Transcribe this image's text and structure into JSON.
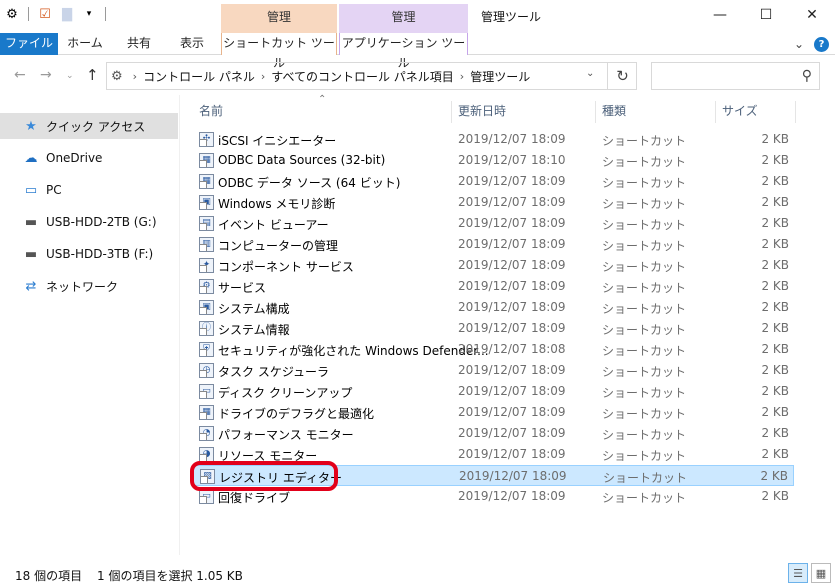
{
  "ribbon": {
    "context_group_1": "管理",
    "context_group_2": "管理",
    "window_title": "管理ツール",
    "tabs": [
      "ファイル",
      "ホーム",
      "共有",
      "表示",
      "ショートカット ツール",
      "アプリケーション ツール"
    ]
  },
  "address": {
    "crumbs": [
      "コントロール パネル",
      "すべてのコントロール パネル項目",
      "管理ツール"
    ]
  },
  "sidebar": {
    "items": [
      {
        "label": "クイック アクセス",
        "icon": "star-icon"
      },
      {
        "label": "OneDrive",
        "icon": "cloud-icon"
      },
      {
        "label": "PC",
        "icon": "pc-icon"
      },
      {
        "label": "USB-HDD-2TB (G:)",
        "icon": "drive-icon"
      },
      {
        "label": "USB-HDD-3TB (F:)",
        "icon": "drive-icon"
      },
      {
        "label": "ネットワーク",
        "icon": "network-icon"
      }
    ]
  },
  "columns": {
    "name": "名前",
    "date": "更新日時",
    "type": "種類",
    "size": "サイズ"
  },
  "files": [
    {
      "name": "iSCSI イニシエーター",
      "date": "2019/12/07 18:09",
      "type": "ショートカット",
      "size": "2 KB"
    },
    {
      "name": "ODBC Data Sources (32-bit)",
      "date": "2019/12/07 18:10",
      "type": "ショートカット",
      "size": "2 KB"
    },
    {
      "name": "ODBC データ ソース (64 ビット)",
      "date": "2019/12/07 18:09",
      "type": "ショートカット",
      "size": "2 KB"
    },
    {
      "name": "Windows メモリ診断",
      "date": "2019/12/07 18:09",
      "type": "ショートカット",
      "size": "2 KB"
    },
    {
      "name": "イベント ビューアー",
      "date": "2019/12/07 18:09",
      "type": "ショートカット",
      "size": "2 KB"
    },
    {
      "name": "コンピューターの管理",
      "date": "2019/12/07 18:09",
      "type": "ショートカット",
      "size": "2 KB"
    },
    {
      "name": "コンポーネント サービス",
      "date": "2019/12/07 18:09",
      "type": "ショートカット",
      "size": "2 KB"
    },
    {
      "name": "サービス",
      "date": "2019/12/07 18:09",
      "type": "ショートカット",
      "size": "2 KB"
    },
    {
      "name": "システム構成",
      "date": "2019/12/07 18:09",
      "type": "ショートカット",
      "size": "2 KB"
    },
    {
      "name": "システム情報",
      "date": "2019/12/07 18:09",
      "type": "ショートカット",
      "size": "2 KB"
    },
    {
      "name": "セキュリティが強化された Windows Defender...",
      "date": "2019/12/07 18:08",
      "type": "ショートカット",
      "size": "2 KB"
    },
    {
      "name": "タスク スケジューラ",
      "date": "2019/12/07 18:09",
      "type": "ショートカット",
      "size": "2 KB"
    },
    {
      "name": "ディスク クリーンアップ",
      "date": "2019/12/07 18:09",
      "type": "ショートカット",
      "size": "2 KB"
    },
    {
      "name": "ドライブのデフラグと最適化",
      "date": "2019/12/07 18:09",
      "type": "ショートカット",
      "size": "2 KB"
    },
    {
      "name": "パフォーマンス モニター",
      "date": "2019/12/07 18:09",
      "type": "ショートカット",
      "size": "2 KB"
    },
    {
      "name": "リソース モニター",
      "date": "2019/12/07 18:09",
      "type": "ショートカット",
      "size": "2 KB"
    },
    {
      "name": "レジストリ エディター",
      "date": "2019/12/07 18:09",
      "type": "ショートカット",
      "size": "2 KB",
      "selected": true
    },
    {
      "name": "回復ドライブ",
      "date": "2019/12/07 18:09",
      "type": "ショートカット",
      "size": "2 KB"
    }
  ],
  "status": {
    "count": "18 個の項目",
    "selection": "1 個の項目を選択  1.05 KB"
  },
  "colors": {
    "file_tab": "#1979ca",
    "selected_row": "#cce8ff",
    "highlight_ring": "#e2001a"
  }
}
